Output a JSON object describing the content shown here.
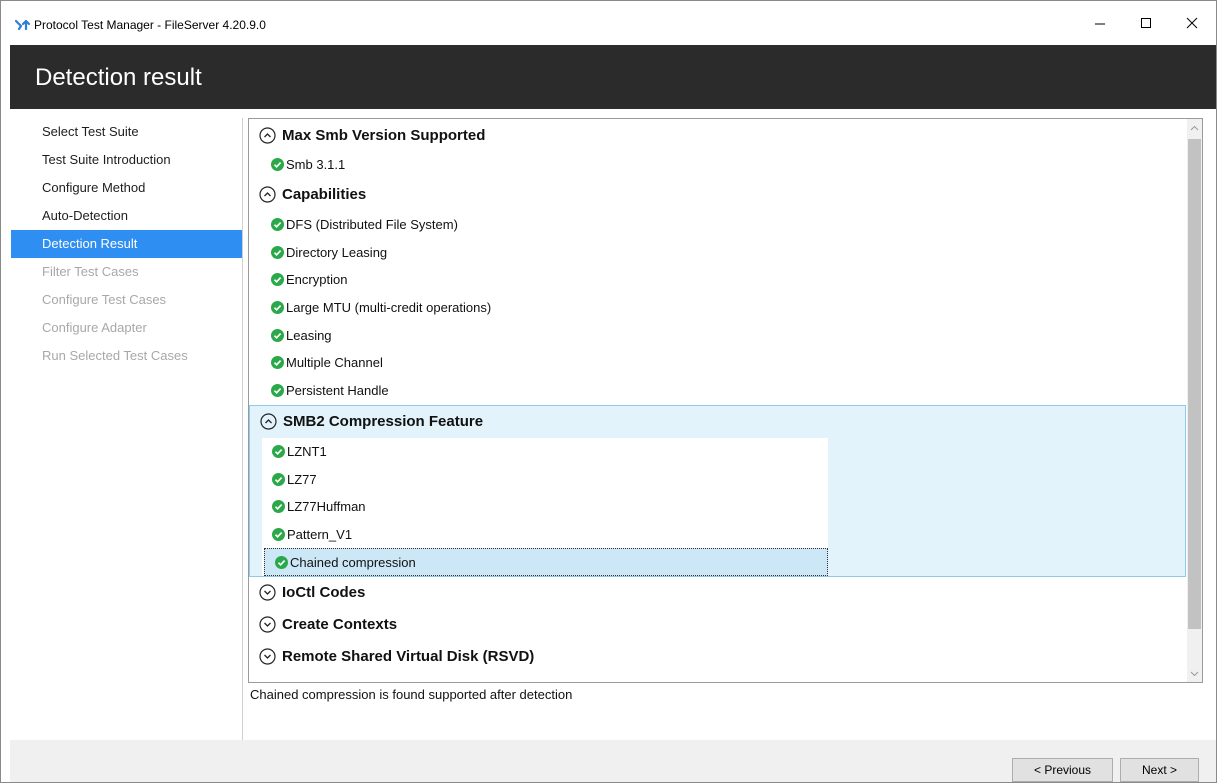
{
  "window": {
    "title": "Protocol Test Manager - FileServer 4.20.9.0"
  },
  "header": {
    "title": "Detection result"
  },
  "nav": {
    "items": [
      {
        "label": "Select Test Suite",
        "state": "normal"
      },
      {
        "label": "Test Suite Introduction",
        "state": "normal"
      },
      {
        "label": "Configure Method",
        "state": "normal"
      },
      {
        "label": "Auto-Detection",
        "state": "normal"
      },
      {
        "label": "Detection Result",
        "state": "active"
      },
      {
        "label": "Filter Test Cases",
        "state": "disabled"
      },
      {
        "label": "Configure Test Cases",
        "state": "disabled"
      },
      {
        "label": "Configure Adapter",
        "state": "disabled"
      },
      {
        "label": "Run Selected Test Cases",
        "state": "disabled"
      }
    ]
  },
  "groups": [
    {
      "title": "Max Smb Version Supported",
      "expanded": true,
      "items": [
        "Smb 3.1.1"
      ]
    },
    {
      "title": "Capabilities",
      "expanded": true,
      "items": [
        "DFS (Distributed File System)",
        "Directory Leasing",
        "Encryption",
        "Large MTU (multi-credit operations)",
        "Leasing",
        "Multiple Channel",
        "Persistent Handle"
      ]
    },
    {
      "title": "SMB2 Compression Feature",
      "expanded": true,
      "items": [
        "LZNT1",
        "LZ77",
        "LZ77Huffman",
        "Pattern_V1",
        "Chained compression"
      ]
    },
    {
      "title": "IoCtl Codes",
      "expanded": false,
      "items": []
    },
    {
      "title": "Create Contexts",
      "expanded": false,
      "items": []
    },
    {
      "title": "Remote Shared Virtual Disk (RSVD)",
      "expanded": false,
      "items": []
    }
  ],
  "status_text": "Chained compression is found supported after detection",
  "footer": {
    "previous_label": "< Previous",
    "next_label": "Next >"
  },
  "colors": {
    "header_bg": "#2b2b2b",
    "nav_active": "#2e8ef2",
    "check_green": "#2aa84a",
    "highlight_bg": "#e3f3fb"
  }
}
